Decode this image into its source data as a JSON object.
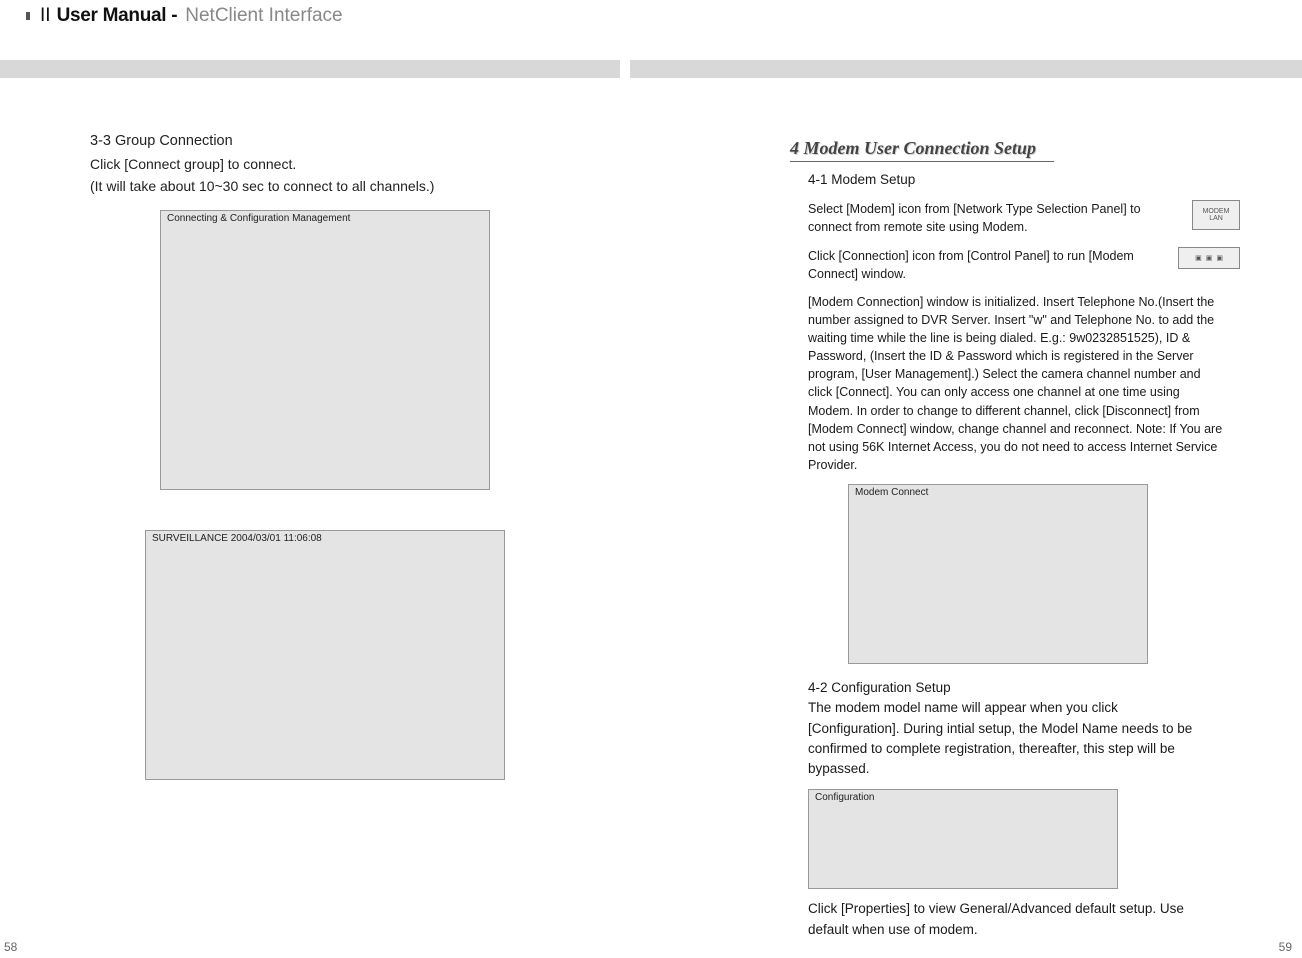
{
  "header": {
    "roman": "II",
    "title_strong": "User Manual -",
    "subtitle": "NetClient Interface"
  },
  "left": {
    "sec33_title": "3-3 Group Connection",
    "sec33_line1": "Click [Connect group] to connect.",
    "sec33_line2": " (It will take about 10~30 sec to connect to all channels.)",
    "fig1_caption": "Connecting & Configuration Management",
    "fig2_caption": "SURVEILLANCE  2004/03/01  11:06:08",
    "page_num": "58"
  },
  "right": {
    "section4_title": "4 Modem User Connection Setup",
    "sec41_title": "4-1 Modem Setup",
    "sec41_p1": "Select [Modem] icon from [Network Type Selection Panel] to connect from remote site using Modem.",
    "sec41_p2": "Click [Connection] icon from [Control Panel] to run [Modem Connect] window.",
    "sec41_p3": "[Modem Connection] window is initialized. Insert Telephone No.(Insert the number assigned to DVR Server. Insert \"w\" and Telephone No. to add the waiting time while the line is being dialed. E.g.: 9w0232851525), ID & Password, (Insert the ID & Password which is registered in the Server program, [User Management].) Select the camera channel number and click [Connect]. You can only access one channel at one time using Modem. In order to change to different channel, click [Disconnect] from [Modem Connect] window, change channel and reconnect. Note: If You are not using 56K Internet Access, you do not need to access Internet Service Provider.",
    "fig3_caption": "Modem Connect",
    "sec42_title": "4-2 Configuration Setup",
    "sec42_p1": "The modem model name will appear when you click [Configuration]. During intial setup, the Model Name needs to be confirmed to complete registration, thereafter, this step will be bypassed.",
    "fig4_caption": "Configuration",
    "sec42_p2": "Click [Properties] to view General/Advanced default setup. Use default when use of modem.",
    "modem_icon_top": "MODEM",
    "modem_icon_bottom": "LAN",
    "page_num": "59"
  }
}
